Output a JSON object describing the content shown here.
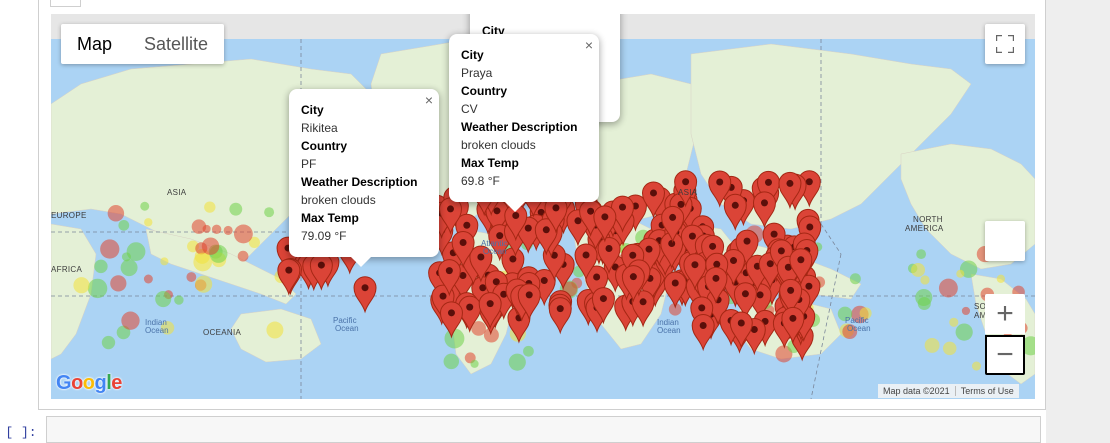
{
  "cell": {
    "prompt_label": "In [ ]:"
  },
  "map": {
    "type_buttons": [
      {
        "label": "Map",
        "active": true
      },
      {
        "label": "Satellite",
        "active": false
      }
    ],
    "controls": {
      "fullscreen_icon": "fullscreen-icon",
      "pegman_icon": "pegman-icon",
      "zoom_in_label": "+",
      "zoom_out_label": "−"
    },
    "logo": [
      "G",
      "o",
      "o",
      "g",
      "l",
      "e"
    ],
    "logo_colors": [
      "#4285F4",
      "#EA4335",
      "#FBBC05",
      "#4285F4",
      "#34A853",
      "#EA4335"
    ],
    "attribution": {
      "map_data": "Map data ©2021",
      "terms": "Terms of Use"
    },
    "region_labels": {
      "asia_left": "ASIA",
      "asia_right": "ASIA",
      "europe": "EUROPE",
      "africa": "AFRICA",
      "oceania": "OCEANIA",
      "north_america_1": "NORTH",
      "north_america_2": "AMERICA",
      "south_america_1": "SO",
      "south_america_2": "AM"
    },
    "ocean_labels": {
      "indian_1a": "Indian",
      "indian_1b": "Ocean",
      "pacific_1a": "Pacific",
      "pacific_1b": "Ocean",
      "atlantic_1a": "Atlantic",
      "atlantic_1b": "Ocean",
      "indian_2a": "Indian",
      "indian_2b": "Ocean",
      "pacific_2a": "Pacific",
      "pacific_2b": "Ocean"
    },
    "marker_color": "#db4437",
    "heat_colors": [
      "#6fd14a",
      "#f2e23a",
      "#e0452f"
    ]
  },
  "info_windows": [
    {
      "labels": [
        "City",
        "Country",
        "Weather Description",
        "Max Temp"
      ],
      "values": [
        "Rikitea",
        "PF",
        "broken clouds",
        "79.09 °F"
      ],
      "close": "×"
    },
    {
      "labels": [
        "City",
        "Country",
        "Weather Description",
        "Max Temp"
      ],
      "values": [
        "Praya",
        "CV",
        "broken clouds",
        "69.8 °F"
      ],
      "close": "×"
    },
    {
      "labels": [
        "City"
      ],
      "values": [],
      "close": ""
    }
  ]
}
